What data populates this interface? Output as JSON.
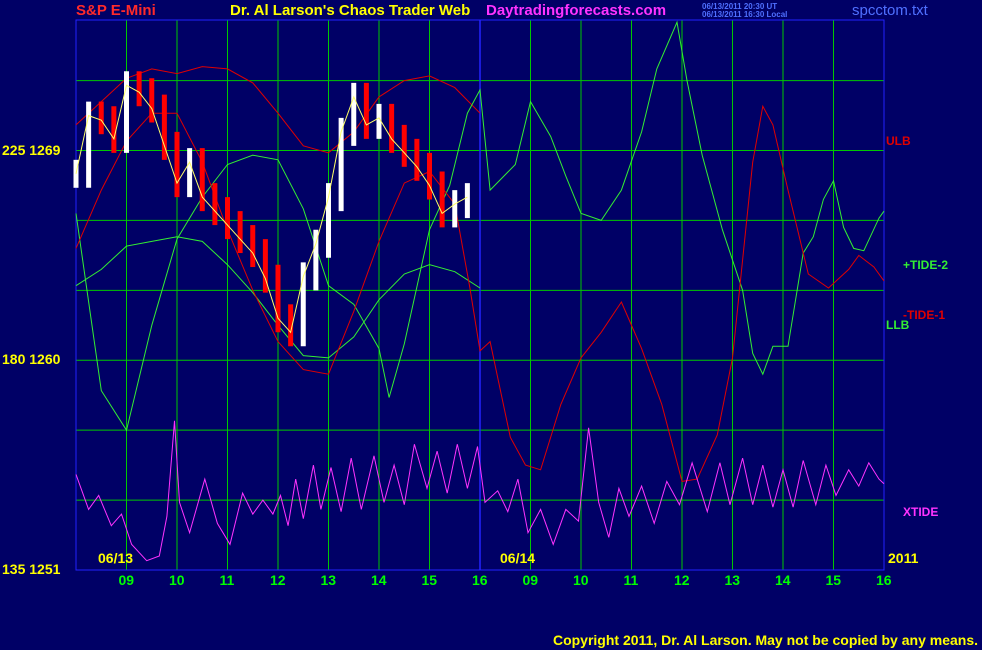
{
  "header": {
    "symbol": "S&P E-Mini",
    "title": "Dr. Al Larson's Chaos Trader Web",
    "site": "Daytradingforecasts.com",
    "stamp_ut": "06/13/2011 20:30 UT",
    "stamp_local": "06/13/2011 16:30 Local",
    "file": "spcctom.txt"
  },
  "colors": {
    "background": "#000066",
    "grid": "#00c800",
    "price_up": "#ffffff",
    "price_down": "#ff0000",
    "band": "#e00000",
    "tide_plus": "#33ee33",
    "tide_minus": "#e00000",
    "xtide": "#ff33ff",
    "forecast_divider": "#2222ff"
  },
  "footer": {
    "copyright": "Copyright 2011, Dr. Al Larson. May not be copied by any means."
  },
  "chart_data": {
    "type": "line",
    "title": "Dr. Al Larson's Chaos Trader Web",
    "y_axis": {
      "ticks": [
        {
          "left": "135",
          "right": "1251",
          "price": 1251
        },
        {
          "left": "180",
          "right": "1260",
          "price": 1260
        },
        {
          "left": "225",
          "right": "1269",
          "price": 1269
        }
      ],
      "range": [
        1251,
        1274.6
      ]
    },
    "x_axis": {
      "hours": [
        "09",
        "10",
        "11",
        "12",
        "13",
        "14",
        "15",
        "16",
        "09",
        "10",
        "11",
        "12",
        "13",
        "14",
        "15",
        "16"
      ],
      "date_labels": [
        "06/13",
        "06/14"
      ],
      "year_label": "2011",
      "range": [
        0,
        16
      ]
    },
    "forecast_start_x": 8,
    "series": [
      {
        "name": "S&P E-Mini price",
        "kind": "price",
        "x": [
          0,
          0.25,
          0.5,
          0.75,
          1,
          1.25,
          1.5,
          1.75,
          2,
          2.25,
          2.5,
          2.75,
          3,
          3.25,
          3.5,
          3.75,
          4,
          4.25,
          4.5,
          4.75,
          5,
          5.25,
          5.5,
          5.75,
          6,
          6.25,
          6.5,
          6.75,
          7,
          7.25,
          7.5,
          7.75
        ],
        "price": [
          1268,
          1270.5,
          1270.3,
          1269.5,
          1271.8,
          1271.5,
          1270.8,
          1269.2,
          1267.6,
          1268.5,
          1267,
          1266.4,
          1265.8,
          1265.2,
          1264.6,
          1263.5,
          1261.8,
          1261.2,
          1263.6,
          1265,
          1267,
          1269.8,
          1271.3,
          1270.1,
          1270.4,
          1269.5,
          1268.9,
          1268.3,
          1267.5,
          1266.3,
          1266.7,
          1267
        ]
      },
      {
        "name": "ULB",
        "kind": "band",
        "x": [
          0,
          0.5,
          1,
          1.5,
          2,
          2.5,
          3,
          3.5,
          4,
          4.5,
          5,
          5.5,
          6,
          6.5,
          7,
          7.5,
          8
        ],
        "price": [
          1270.1,
          1271.1,
          1272.1,
          1272.5,
          1272.3,
          1272.6,
          1272.5,
          1271.9,
          1270.6,
          1269.2,
          1268.9,
          1269.8,
          1271.3,
          1272,
          1272.2,
          1271.7,
          1270.6
        ]
      },
      {
        "name": "LLB",
        "kind": "band",
        "x": [
          0,
          0.5,
          1,
          1.5,
          2,
          2.5,
          3,
          3.5,
          4,
          4.5,
          5,
          5.5,
          6,
          6.5,
          7,
          7.5,
          8
        ],
        "price": [
          1263.2,
          1263.9,
          1264.9,
          1265.1,
          1265.3,
          1265.1,
          1264.1,
          1262.9,
          1261.5,
          1260.2,
          1260.1,
          1261,
          1262.6,
          1263.7,
          1264.1,
          1263.8,
          1263.1
        ]
      },
      {
        "name": "+TIDE-2",
        "kind": "tide",
        "x": [
          0,
          0.5,
          1,
          1.5,
          2,
          2.5,
          3,
          3.5,
          4,
          4.5,
          5,
          5.5,
          6,
          6.2,
          6.5,
          7,
          7.4,
          7.75,
          8,
          8.2,
          8.7,
          9,
          9.4,
          9.7,
          10,
          10.4,
          10.8,
          11.2,
          11.5,
          11.9,
          12.1,
          12.4,
          12.8,
          13.2,
          13.4,
          13.6,
          13.8,
          14.1,
          14.4,
          14.6,
          14.8,
          15,
          15.2,
          15.4,
          15.6,
          15.9,
          16
        ],
        "price": [
          1266.3,
          1258.7,
          1257,
          1261.5,
          1265.2,
          1267,
          1268.4,
          1268.8,
          1268.6,
          1266.5,
          1263.2,
          1262.4,
          1260.5,
          1258.4,
          1260.7,
          1265.6,
          1267.5,
          1270.6,
          1271.6,
          1267.3,
          1268.4,
          1271.1,
          1269.6,
          1267.9,
          1266.3,
          1266,
          1267.3,
          1269.8,
          1272.5,
          1274.5,
          1272,
          1268.8,
          1265.6,
          1263,
          1260.3,
          1259.4,
          1260.6,
          1260.6,
          1264.6,
          1265.3,
          1266.9,
          1267.7,
          1265.7,
          1264.8,
          1264.7,
          1266.1,
          1266.4
        ]
      },
      {
        "name": "-TIDE-1",
        "kind": "tide",
        "x": [
          0,
          0.5,
          1,
          1.5,
          2,
          2.5,
          3,
          3.5,
          4,
          4.5,
          5,
          5.5,
          6,
          6.5,
          7,
          7.5,
          7.8,
          8,
          8.2,
          8.6,
          8.9,
          9.2,
          9.6,
          10,
          10.4,
          10.8,
          11.2,
          11.6,
          12,
          12.3,
          12.7,
          13,
          13.2,
          13.4,
          13.6,
          13.8,
          14.1,
          14.5,
          14.9,
          15.3,
          15.5,
          15.8,
          16
        ],
        "price": [
          1264.8,
          1267.3,
          1269.4,
          1270.6,
          1270.6,
          1268.5,
          1265.6,
          1263,
          1260.8,
          1259.6,
          1259.4,
          1262.1,
          1265.1,
          1267.6,
          1268.1,
          1266.7,
          1263.1,
          1260.4,
          1260.8,
          1256.7,
          1255.5,
          1255.3,
          1258.1,
          1260.1,
          1261.2,
          1262.5,
          1260.5,
          1258.1,
          1254.8,
          1254.9,
          1256.8,
          1260.1,
          1264.3,
          1268.5,
          1270.9,
          1270.1,
          1267.3,
          1263.7,
          1263.1,
          1263.9,
          1264.5,
          1264,
          1263.4
        ]
      },
      {
        "name": "XTIDE",
        "kind": "xtide",
        "x": [
          0,
          0.25,
          0.45,
          0.7,
          0.9,
          1.1,
          1.4,
          1.65,
          1.8,
          1.95,
          2.05,
          2.25,
          2.55,
          2.8,
          3.05,
          3.3,
          3.5,
          3.7,
          3.9,
          4.05,
          4.2,
          4.35,
          4.5,
          4.7,
          4.85,
          5.05,
          5.25,
          5.45,
          5.65,
          5.9,
          6.1,
          6.3,
          6.5,
          6.7,
          6.95,
          7.15,
          7.35,
          7.55,
          7.75,
          7.95,
          8.1,
          8.35,
          8.55,
          8.75,
          8.95,
          9.2,
          9.45,
          9.7,
          9.95,
          10.15,
          10.35,
          10.55,
          10.75,
          10.95,
          11.2,
          11.45,
          11.7,
          11.95,
          12.2,
          12.5,
          12.75,
          12.95,
          13.2,
          13.4,
          13.6,
          13.8,
          14,
          14.2,
          14.4,
          14.65,
          14.85,
          15.05,
          15.3,
          15.5,
          15.7,
          15.9,
          16
        ],
        "price": [
          1255.1,
          1253.6,
          1254.2,
          1252.9,
          1253.4,
          1252.1,
          1251.4,
          1251.6,
          1253.3,
          1257.4,
          1253.9,
          1252.6,
          1254.9,
          1253,
          1252.1,
          1254.3,
          1253.4,
          1254,
          1253.4,
          1254.2,
          1252.9,
          1254.9,
          1253.2,
          1255.5,
          1253.6,
          1255.4,
          1253.5,
          1255.8,
          1253.6,
          1255.9,
          1253.9,
          1255.5,
          1253.8,
          1256.4,
          1254.5,
          1256.1,
          1254.3,
          1256.4,
          1254.5,
          1256.3,
          1253.9,
          1254.4,
          1253.5,
          1254.9,
          1252.6,
          1253.6,
          1252.1,
          1253.6,
          1253.1,
          1257.1,
          1253.9,
          1252.4,
          1254.5,
          1253.3,
          1254.6,
          1253,
          1254.8,
          1253.8,
          1255.6,
          1253.5,
          1255.6,
          1253.8,
          1255.8,
          1253.8,
          1255.5,
          1253.7,
          1255.3,
          1253.7,
          1255.7,
          1253.8,
          1255.5,
          1254.2,
          1255.3,
          1254.6,
          1255.6,
          1254.9,
          1254.7
        ]
      }
    ]
  }
}
